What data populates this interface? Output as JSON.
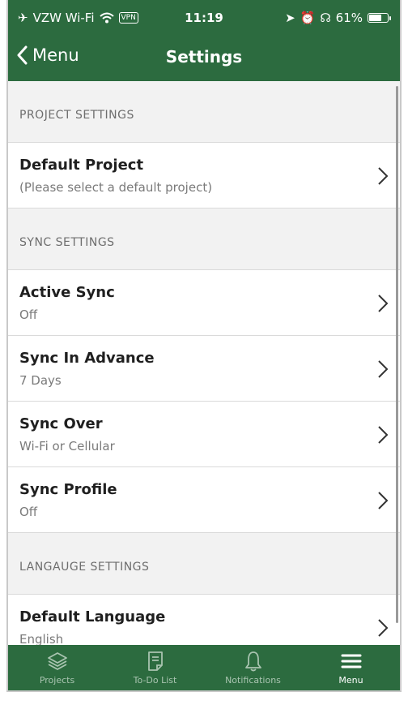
{
  "status": {
    "carrier": "VZW Wi-Fi",
    "vpn": "VPN",
    "time": "11:19",
    "battery": "61%",
    "battery_level": 0.61
  },
  "nav": {
    "back_label": "Menu",
    "title": "Settings"
  },
  "sections": [
    {
      "header": "PROJECT SETTINGS"
    },
    {
      "header": "SYNC SETTINGS"
    },
    {
      "header": "LANGAUGE SETTINGS"
    }
  ],
  "rows": {
    "default_project": {
      "title": "Default Project",
      "value": "(Please select a default project)"
    },
    "active_sync": {
      "title": "Active Sync",
      "value": "Off"
    },
    "sync_in_advance": {
      "title": "Sync In Advance",
      "value": "7 Days"
    },
    "sync_over": {
      "title": "Sync Over",
      "value": "Wi-Fi or Cellular"
    },
    "sync_profile": {
      "title": "Sync Profile",
      "value": "Off"
    },
    "default_language": {
      "title": "Default Language",
      "value": "English"
    }
  },
  "tabs": [
    {
      "label": "Projects",
      "icon": "layers-icon"
    },
    {
      "label": "To-Do List",
      "icon": "checklist-icon"
    },
    {
      "label": "Notifications",
      "icon": "bell-icon"
    },
    {
      "label": "Menu",
      "icon": "hamburger-icon",
      "active": true
    }
  ],
  "colors": {
    "brand_green": "#2c6b3f",
    "section_bg": "#f2f2f2",
    "tab_inactive": "#a9c4b0"
  }
}
